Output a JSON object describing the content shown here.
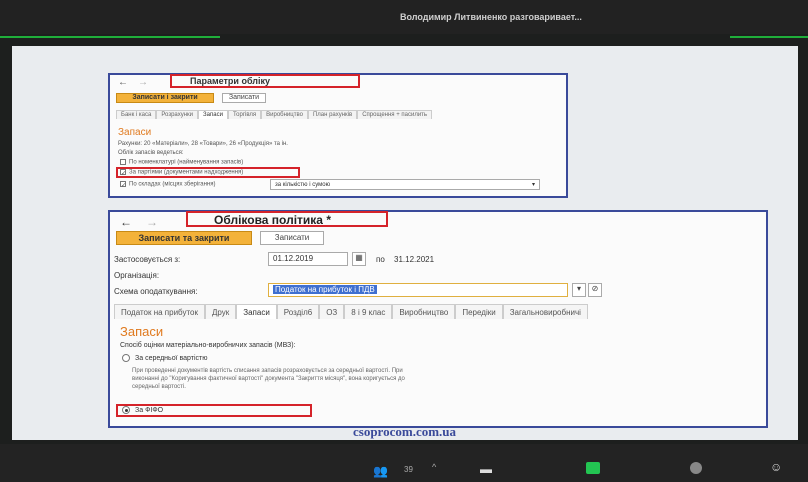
{
  "header": {
    "speaker_text": "Володимир Литвиненко разговаривает..."
  },
  "panel1": {
    "title": "Параметри обліку",
    "save_close": "Записати і закрити",
    "save": "Записати",
    "tabs": [
      "Банк і каса",
      "Розрахунки",
      "Запаси",
      "Торгівля",
      "Виробництво",
      "План рахунків",
      "Спрощення + пасилить"
    ],
    "section": "Запаси",
    "line1": "Рахунки: 20 «Матеріали», 28 «Товари», 26 «Продукція» та ін.",
    "line2": "Облік запасів ведеться:",
    "opt1": "По номенклатурі (найменування запасів)",
    "opt2": "За партіями (документами надходження)",
    "opt3": "По складах (місцях зберігання)",
    "select": "за кількістю і сумою"
  },
  "panel2": {
    "title": "Облікова політика *",
    "save_close": "Записати та закрити",
    "save": "Записати",
    "applies_label": "Застосовується з:",
    "date_from": "01.12.2019",
    "date_to_label": "по",
    "date_to": "31.12.2021",
    "org_label": "Організація:",
    "scheme_label": "Схема оподаткування:",
    "scheme_value": "Податок на прибуток і ПДВ",
    "tabs": [
      "Податок на прибуток",
      "Друк",
      "Запаси",
      "Розділ6",
      "ОЗ",
      "8 і 9 клас",
      "Виробництво",
      "Передіки",
      "Загальновиробничі"
    ],
    "section": "Запаси",
    "method_label": "Спосіб оцінки матеріально-виробничих запасів (МВЗ):",
    "avg_label": "За середньої вартістю",
    "avg_desc": "При проведенні документів вартість списання запасів розраховується за середньої вартості. При виконанні до \"Коригування фактичної вартості\" документа \"Закриття місяця\", вона коригується до середньої вартості.",
    "fifo_label": "За ФІФО"
  },
  "watermark": "csoprocom.com.ua",
  "footer": {
    "participants": "39"
  }
}
